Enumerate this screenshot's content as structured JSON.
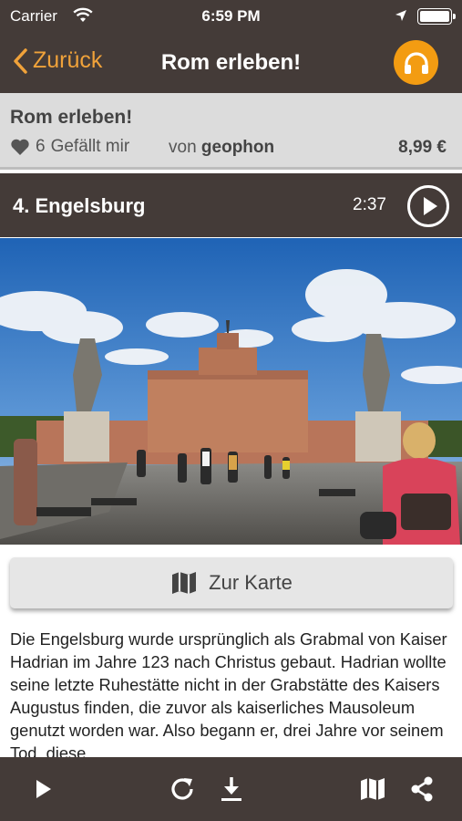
{
  "status_bar": {
    "carrier": "Carrier",
    "time": "6:59 PM"
  },
  "nav": {
    "back_label": "Zurück",
    "title": "Rom erleben!"
  },
  "tour": {
    "title": "Rom erleben!",
    "likes_count": "6",
    "likes_label": "Gefällt mir",
    "author_prefix": "von",
    "author": "geophon",
    "price": "8,99 €"
  },
  "chapter": {
    "title": "4. Engelsburg",
    "duration": "2:37"
  },
  "map_button": {
    "label": "Zur Karte"
  },
  "description": "Die Engelsburg wurde ursprünglich als Grabmal von Kaiser Hadrian im Jahre 123 nach Christus gebaut. Hadrian wollte seine letzte Ruhestätte nicht in der Grabstätte des Kaisers Augustus finden, die zuvor als kaiserliches Mausoleum genutzt worden war. Also begann er, drei Jahre vor seinem Tod, diese",
  "colors": {
    "bar": "#443b38",
    "accent": "#f39c12",
    "back": "#f0a23a",
    "info_bg": "#dcdcdc"
  },
  "icons": {
    "wifi": "wifi-icon",
    "location": "location-arrow-icon",
    "battery": "battery-icon",
    "headphones": "headphones-icon",
    "heart": "heart-icon",
    "play": "play-icon",
    "map": "map-icon",
    "reload": "reload-icon",
    "download": "download-icon",
    "share": "share-icon"
  }
}
